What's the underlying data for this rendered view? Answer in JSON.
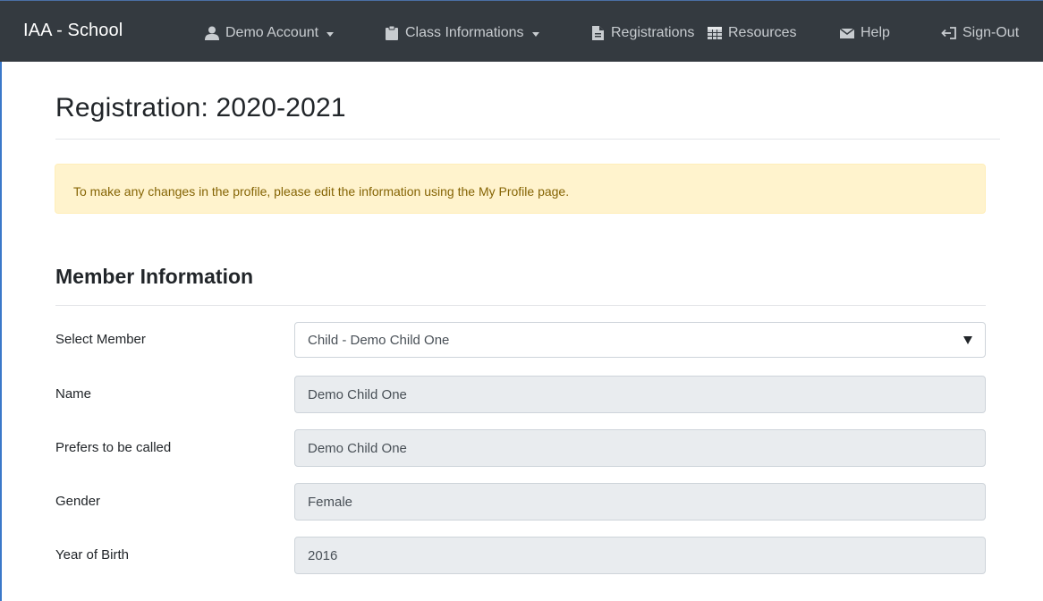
{
  "navbar": {
    "brand": "IAA - School",
    "items": [
      {
        "label": "Demo Account",
        "icon": "user-icon",
        "dropdown": true
      },
      {
        "label": "Class Informations",
        "icon": "clipboard-icon",
        "dropdown": true
      },
      {
        "label": "Registrations",
        "icon": "file-icon",
        "dropdown": false
      },
      {
        "label": "Resources",
        "icon": "table-icon",
        "dropdown": false
      },
      {
        "label": "Help",
        "icon": "envelope-icon",
        "dropdown": false
      },
      {
        "label": "Sign-Out",
        "icon": "sign-out-icon",
        "dropdown": false
      }
    ]
  },
  "page": {
    "title": "Registration: 2020-2021",
    "alert": "To make any changes in the profile, please edit the information using the My Profile page."
  },
  "member_section": {
    "title": "Member Information",
    "select_member": {
      "label": "Select Member",
      "value": "Child - Demo Child One"
    },
    "fields": [
      {
        "label": "Name",
        "value": "Demo Child One"
      },
      {
        "label": "Prefers to be called",
        "value": "Demo Child One"
      },
      {
        "label": "Gender",
        "value": "Female"
      },
      {
        "label": "Year of Birth",
        "value": "2016"
      }
    ]
  },
  "colors": {
    "navbar_bg": "#343a40",
    "alert_bg": "#fff3cd",
    "alert_text": "#856404",
    "readonly_bg": "#e9ecef"
  }
}
